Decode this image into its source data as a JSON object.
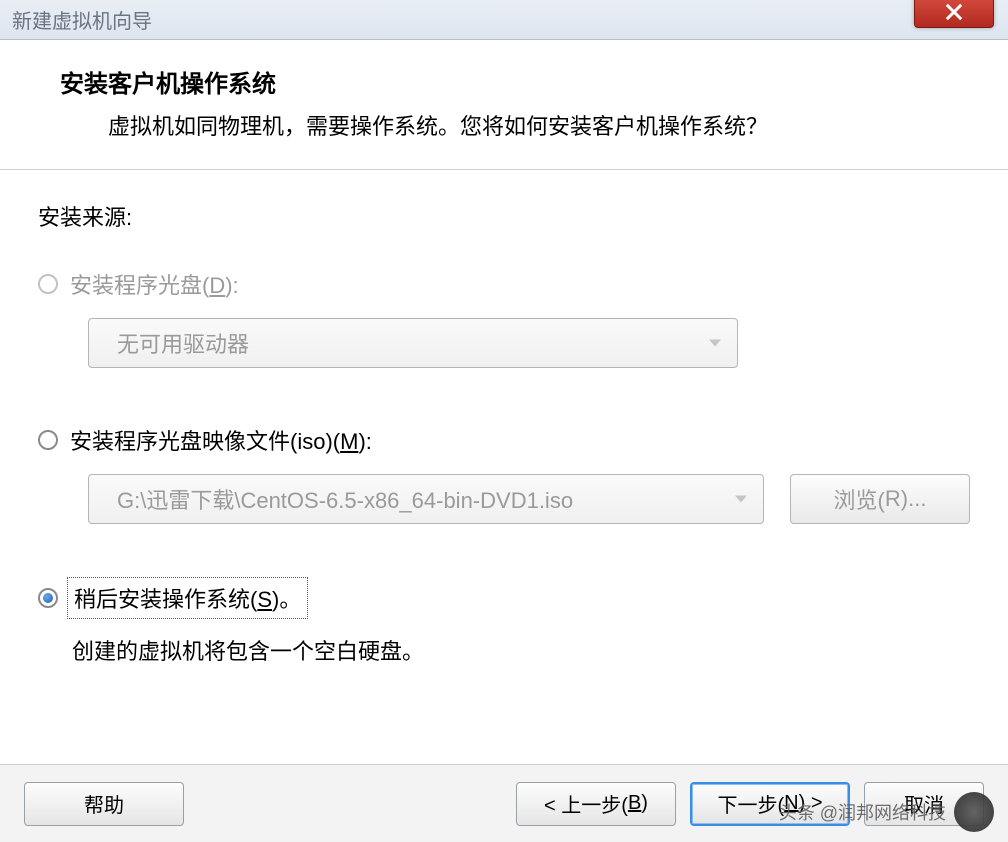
{
  "window": {
    "title": "新建虚拟机向导"
  },
  "header": {
    "heading": "安装客户机操作系统",
    "subtext": "虚拟机如同物理机，需要操作系统。您将如何安装客户机操作系统？"
  },
  "body": {
    "source_label": "安装来源:",
    "option_disc": {
      "label_prefix": "安装程序光盘(",
      "hotkey": "D",
      "label_suffix": "):",
      "dropdown_value": "无可用驱动器",
      "enabled": false,
      "checked": false
    },
    "option_iso": {
      "label_prefix": "安装程序光盘映像文件(iso)(",
      "hotkey": "M",
      "label_suffix": "):",
      "dropdown_value": "G:\\迅雷下载\\CentOS-6.5-x86_64-bin-DVD1.iso",
      "browse_prefix": "浏览(",
      "browse_hotkey": "R",
      "browse_suffix": ")...",
      "enabled": false,
      "checked": false
    },
    "option_later": {
      "label_prefix": "稍后安装操作系统(",
      "hotkey": "S",
      "label_suffix": ")。",
      "description": "创建的虚拟机将包含一个空白硬盘。",
      "checked": true
    }
  },
  "footer": {
    "help": "帮助",
    "back_prefix": "< 上一步(",
    "back_hotkey": "B",
    "back_suffix": ")",
    "next_prefix": "下一步(",
    "next_hotkey": "N",
    "next_suffix": ") >",
    "cancel": "取消"
  },
  "watermark": {
    "text": "头条 @润邦网络科技"
  }
}
